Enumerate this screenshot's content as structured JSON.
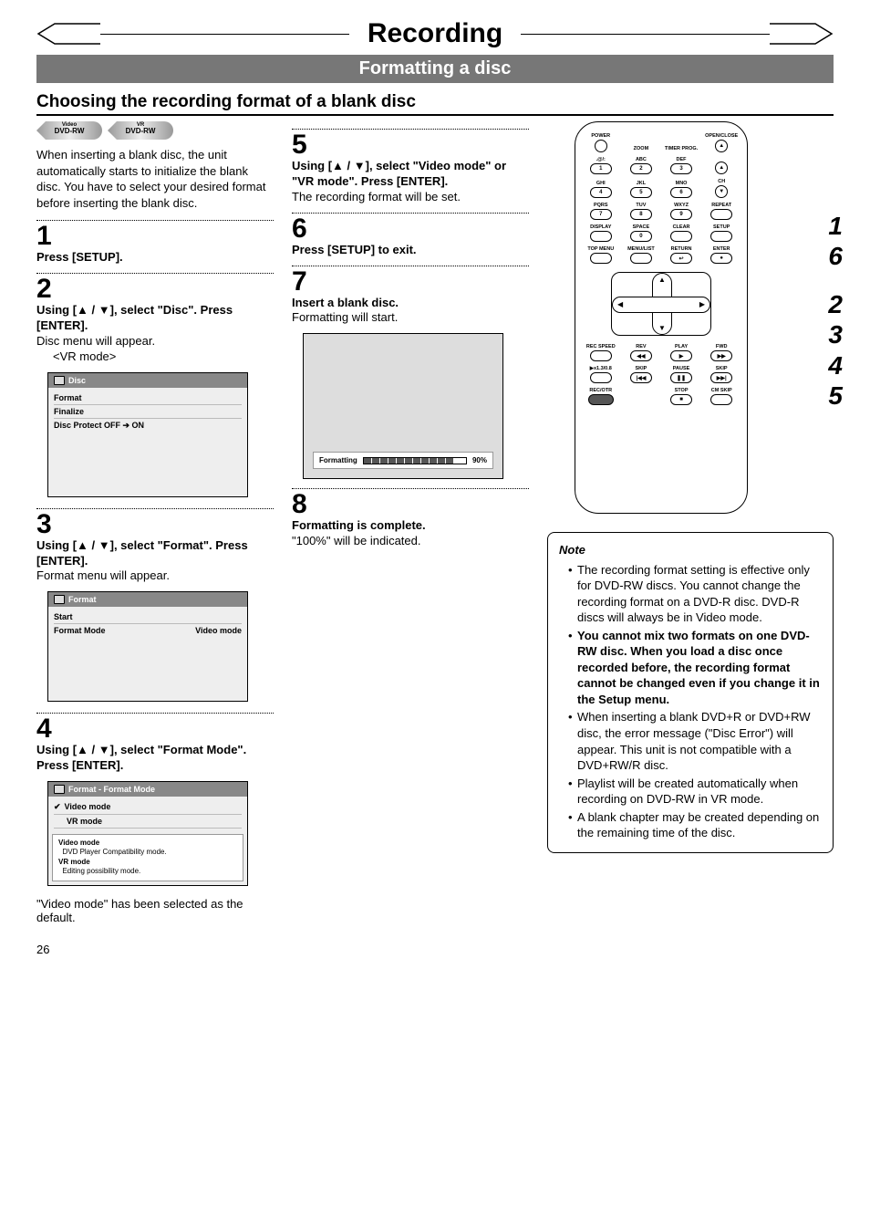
{
  "page_number": "26",
  "title": "Recording",
  "subtitle": "Formatting a disc",
  "section_heading": "Choosing the recording format of a blank disc",
  "badges": {
    "video": {
      "top": "Video",
      "main": "DVD-RW"
    },
    "vr": {
      "top": "VR",
      "main": "DVD-RW"
    }
  },
  "intro": "When inserting a blank disc, the unit automatically starts to initialize the blank disc. You have to select your desired format before inserting the blank disc.",
  "steps": {
    "s1": {
      "num": "1",
      "instr": "Press [SETUP]."
    },
    "s2": {
      "num": "2",
      "instr": "Using [▲ / ▼], select \"Disc\". Press [ENTER].",
      "desc": "Disc menu will appear.",
      "sub": "<VR mode>",
      "menu": {
        "title": "Disc",
        "rows": [
          {
            "label": "Format",
            "right": ""
          },
          {
            "label": "Finalize",
            "right": ""
          },
          {
            "label": "Disc Protect OFF ➔ ON",
            "right": ""
          }
        ]
      }
    },
    "s3": {
      "num": "3",
      "instr": "Using [▲ / ▼], select \"Format\". Press [ENTER].",
      "desc": "Format menu will appear.",
      "menu": {
        "title": "Format",
        "rows": [
          {
            "label": "Start",
            "right": ""
          },
          {
            "label": "Format Mode",
            "right": "Video mode"
          }
        ]
      }
    },
    "s4": {
      "num": "4",
      "instr": "Using [▲ / ▼], select \"Format Mode\". Press [ENTER].",
      "menu": {
        "title": "Format - Format Mode",
        "rows": [
          {
            "label": "Video mode",
            "check": true
          },
          {
            "label": "VR mode"
          }
        ],
        "info": {
          "l1b": "Video mode",
          "l1": "DVD Player Compatibility mode.",
          "l2b": "VR mode",
          "l2": "Editing possibility mode."
        }
      },
      "below": "\"Video mode\" has been selected as the default."
    },
    "s5": {
      "num": "5",
      "instr": "Using [▲ / ▼], select \"Video mode\" or \"VR mode\". Press [ENTER].",
      "desc": "The recording format will be set."
    },
    "s6": {
      "num": "6",
      "instr": "Press [SETUP] to exit."
    },
    "s7": {
      "num": "7",
      "instr": "Insert a blank disc.",
      "desc": "Formatting will start.",
      "progress": {
        "label": "Formatting",
        "pct": "90%"
      }
    },
    "s8": {
      "num": "8",
      "instr": "Formatting is complete.",
      "desc": "\"100%\" will be indicated."
    }
  },
  "remote": {
    "labels": {
      "power": "POWER",
      "zoom": "ZOOM",
      "timer": "TIMER PROG.",
      "open": "OPEN/CLOSE",
      "at": ".@/:",
      "abc": "ABC",
      "def": "DEF",
      "ghi": "GHI",
      "jkl": "JKL",
      "mno": "MNO",
      "ch": "CH",
      "pqrs": "PQRS",
      "tuv": "TUV",
      "wxyz": "WXYZ",
      "repeat": "REPEAT",
      "display": "DISPLAY",
      "space": "SPACE",
      "clear": "CLEAR",
      "setup": "SETUP",
      "topmenu": "TOP MENU",
      "menulist": "MENU/LIST",
      "return": "RETURN",
      "enter": "ENTER",
      "recspeed": "REC SPEED",
      "rev": "REV",
      "play": "PLAY",
      "fwd": "FWD",
      "x13": "▶x1.3/0.8",
      "skip": "SKIP",
      "pause": "PAUSE",
      "skip2": "SKIP",
      "recotr": "REC/OTR",
      "stop": "STOP",
      "cmskip": "CM SKIP"
    },
    "nums": {
      "n1": "1",
      "n2": "2",
      "n3": "3",
      "n4": "4",
      "n5": "5",
      "n6": "6",
      "n7": "7",
      "n8": "8",
      "n9": "9",
      "n0": "0"
    },
    "callouts": [
      "1",
      "6",
      "2",
      "3",
      "4",
      "5"
    ]
  },
  "note": {
    "title": "Note",
    "items": [
      {
        "text": "The recording format setting is effective only for DVD-RW discs. You cannot change the recording format on a DVD-R disc. DVD-R discs will always be in Video mode."
      },
      {
        "text": "You cannot mix two formats on one DVD-RW disc. When you load a disc once recorded before, the recording format cannot be changed even if you change it in the Setup menu.",
        "bold": true
      },
      {
        "text": "When inserting a blank DVD+R or DVD+RW disc, the error message (\"Disc Error\") will appear. This unit is not compatible with a DVD+RW/R disc."
      },
      {
        "text": "Playlist will be created automatically when recording on DVD-RW in VR mode."
      },
      {
        "text": "A blank chapter may be created depending on the remaining time of the disc."
      }
    ]
  }
}
